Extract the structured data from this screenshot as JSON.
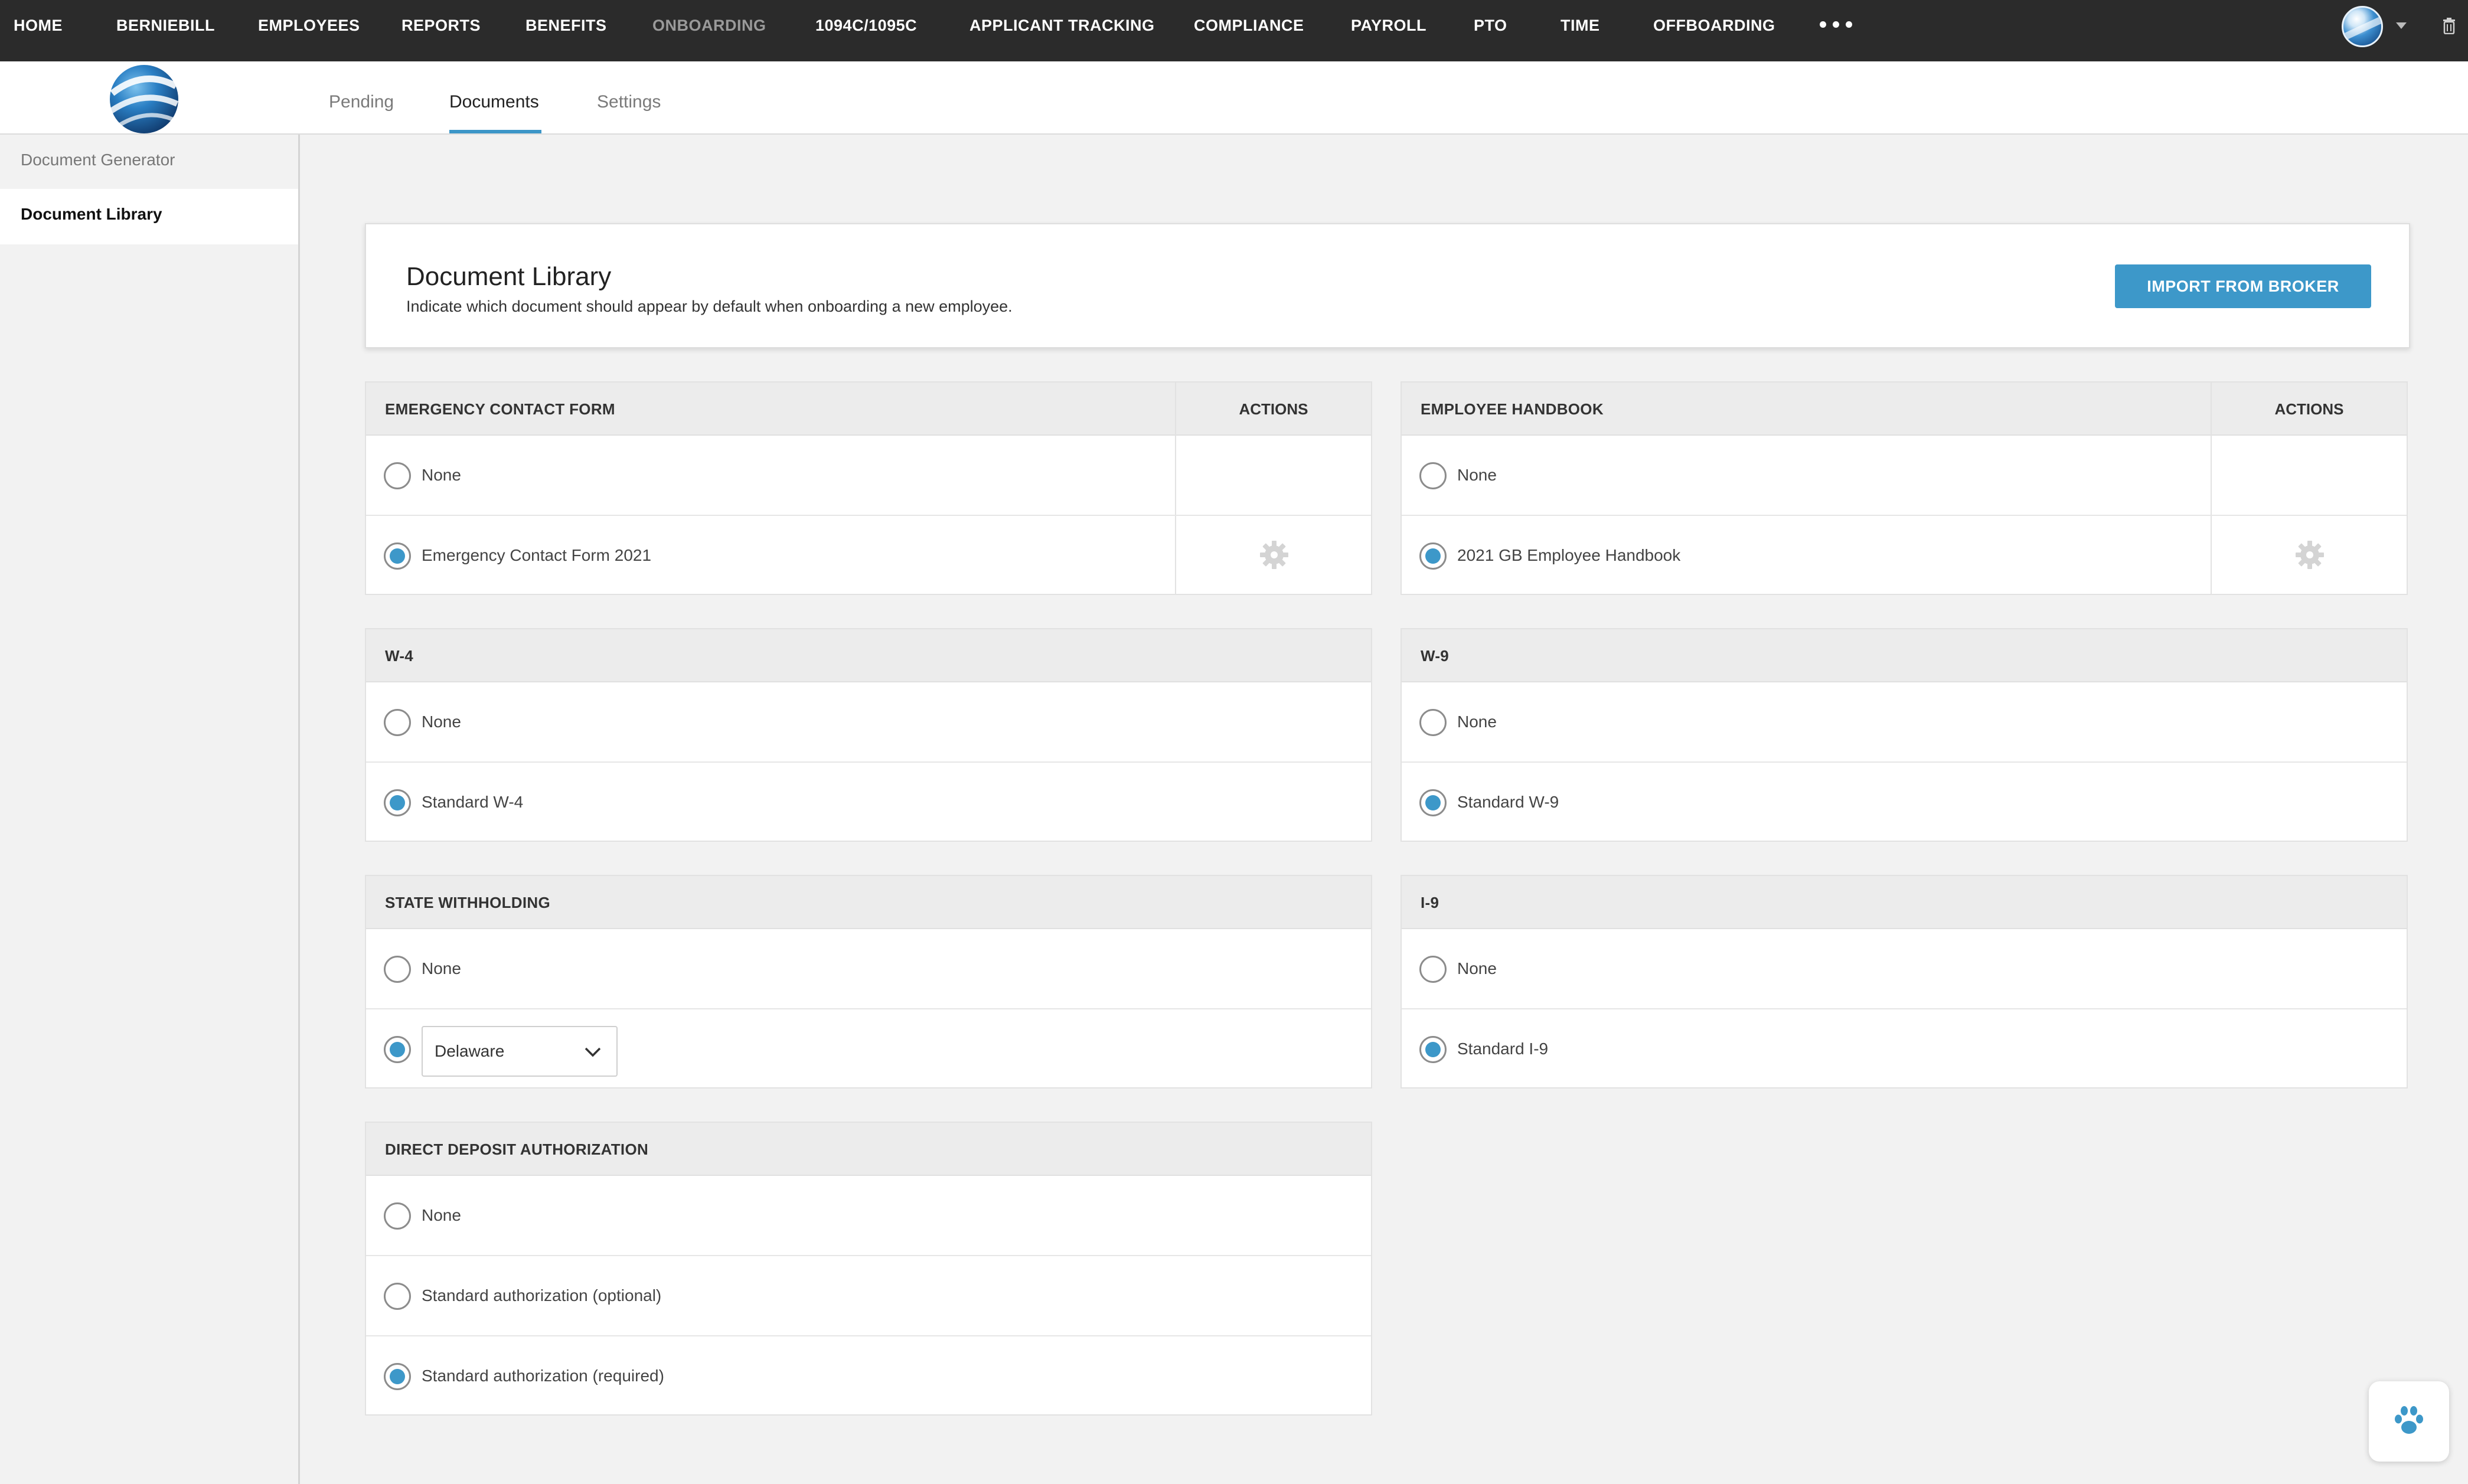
{
  "nav": {
    "items": [
      {
        "label": "HOME"
      },
      {
        "label": "BERNIEBILL"
      },
      {
        "label": "EMPLOYEES"
      },
      {
        "label": "REPORTS"
      },
      {
        "label": "BENEFITS"
      },
      {
        "label": "ONBOARDING"
      },
      {
        "label": "1094C/1095C"
      },
      {
        "label": "APPLICANT TRACKING"
      },
      {
        "label": "COMPLIANCE"
      },
      {
        "label": "PAYROLL"
      },
      {
        "label": "PTO"
      },
      {
        "label": "TIME"
      },
      {
        "label": "OFFBOARDING"
      }
    ],
    "more_icon": "more-dots-icon",
    "active": "ONBOARDING"
  },
  "tabs": [
    {
      "label": "Pending"
    },
    {
      "label": "Documents"
    },
    {
      "label": "Settings"
    }
  ],
  "active_tab": "Documents",
  "sidebar": {
    "items": [
      {
        "label": "Document Generator"
      },
      {
        "label": "Document Library"
      }
    ],
    "active": "Document Library"
  },
  "header": {
    "title": "Document Library",
    "subtitle": "Indicate which document should appear by default when onboarding a new employee.",
    "import_button": "IMPORT FROM BROKER"
  },
  "sections": {
    "emergency": {
      "title": "EMERGENCY CONTACT FORM",
      "actions_label": "ACTIONS",
      "options": [
        {
          "label": "None",
          "selected": false
        },
        {
          "label": "Emergency Contact Form 2021",
          "selected": true
        }
      ]
    },
    "handbook": {
      "title": "EMPLOYEE HANDBOOK",
      "actions_label": "ACTIONS",
      "options": [
        {
          "label": "None",
          "selected": false
        },
        {
          "label": "2021 GB Employee Handbook",
          "selected": true
        }
      ]
    },
    "w4": {
      "title": "W-4",
      "options": [
        {
          "label": "None",
          "selected": false
        },
        {
          "label": "Standard W-4",
          "selected": true
        }
      ]
    },
    "w9": {
      "title": "W-9",
      "options": [
        {
          "label": "None",
          "selected": false
        },
        {
          "label": "Standard W-9",
          "selected": true
        }
      ]
    },
    "state": {
      "title": "STATE WITHHOLDING",
      "options": [
        {
          "label": "None",
          "selected": false
        },
        {
          "label": "",
          "selected": true
        }
      ],
      "state_select": "Delaware"
    },
    "i9": {
      "title": "I-9",
      "options": [
        {
          "label": "None",
          "selected": false
        },
        {
          "label": "Standard I-9",
          "selected": true
        }
      ]
    },
    "deposit": {
      "title": "DIRECT DEPOSIT AUTHORIZATION",
      "options": [
        {
          "label": "None",
          "selected": false
        },
        {
          "label": "Standard authorization (optional)",
          "selected": false
        },
        {
          "label": "Standard authorization (required)",
          "selected": true
        }
      ]
    }
  },
  "colors": {
    "nav_bg": "#2b2b2b",
    "accent": "#3d98c9",
    "page_bg": "#f2f2f2"
  }
}
